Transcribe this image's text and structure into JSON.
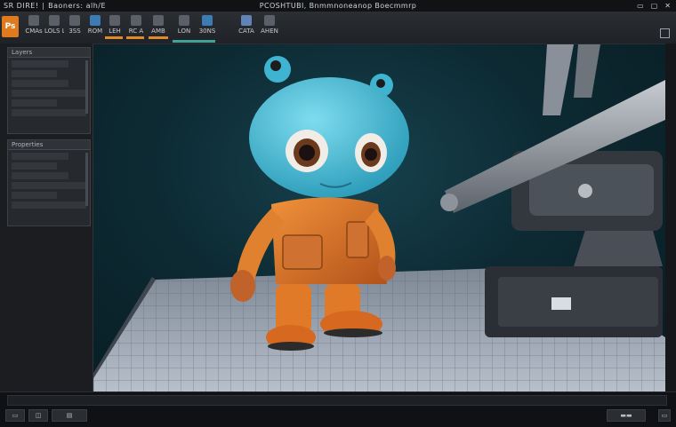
{
  "window": {
    "title_left": "SR DIRE! ∣ Baoners: alh/E",
    "title_center": "PCOSHTUBI, Bnmmnoneanop Boecmmrp",
    "controls": [
      "min-icon",
      "max-icon",
      "close-icon"
    ]
  },
  "toolbar": {
    "logo_label": "Ps",
    "buttons": [
      {
        "name": "tool-1",
        "label": "CMAs"
      },
      {
        "name": "tool-2",
        "label": "LOLS  L0"
      },
      {
        "name": "tool-3",
        "label": "3SS"
      },
      {
        "name": "tool-4",
        "label": "ROM"
      },
      {
        "name": "tool-5",
        "label": "LEH"
      },
      {
        "name": "tool-6",
        "label": "RC  A"
      },
      {
        "name": "tool-7",
        "label": "AMB"
      },
      {
        "name": "tool-8",
        "label": "LON"
      },
      {
        "name": "tool-9",
        "label": "30NS"
      },
      {
        "name": "tool-10",
        "label": "CATA"
      },
      {
        "name": "tool-11",
        "label": "AHEN"
      }
    ]
  },
  "panels": {
    "top_header": "Layers",
    "bottom_header": "Properties"
  },
  "status": {
    "left_items": [
      "▭",
      "◫",
      "▤"
    ],
    "right_items": [
      "▬▬",
      "▭"
    ]
  },
  "colors": {
    "accent": "#e08a2a",
    "teal": "#3fa39a",
    "brand": "#e07a1e"
  }
}
